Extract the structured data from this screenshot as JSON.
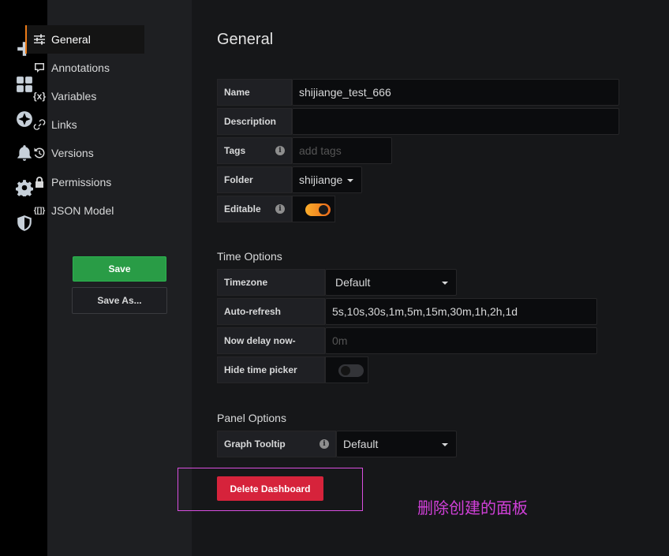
{
  "sidebar": {
    "icons": [
      "plus-icon",
      "dashboards-icon",
      "explore-icon",
      "alerting-icon",
      "configuration-icon",
      "server-admin-icon"
    ],
    "items": [
      {
        "label": "General",
        "icon": "sliders-icon",
        "active": true
      },
      {
        "label": "Annotations",
        "icon": "comment-icon"
      },
      {
        "label": "Variables",
        "icon": "variable-icon",
        "glyph": "{x}"
      },
      {
        "label": "Links",
        "icon": "link-icon"
      },
      {
        "label": "Versions",
        "icon": "history-icon"
      },
      {
        "label": "Permissions",
        "icon": "lock-icon"
      },
      {
        "label": "JSON Model",
        "icon": "json-icon",
        "glyph": "{[]}"
      }
    ],
    "save_label": "Save",
    "save_as_label": "Save As..."
  },
  "main": {
    "title": "General",
    "fields": {
      "name": {
        "label": "Name",
        "value": "shijiange_test_666"
      },
      "description": {
        "label": "Description",
        "value": ""
      },
      "tags": {
        "label": "Tags",
        "placeholder": "add tags"
      },
      "folder": {
        "label": "Folder",
        "value": "shijiange"
      },
      "editable": {
        "label": "Editable",
        "value": true
      }
    },
    "time_options": {
      "title": "Time Options",
      "timezone": {
        "label": "Timezone",
        "value": "Default"
      },
      "auto_refresh": {
        "label": "Auto-refresh",
        "value": "5s,10s,30s,1m,5m,15m,30m,1h,2h,1d"
      },
      "now_delay": {
        "label": "Now delay now-",
        "placeholder": "0m"
      },
      "hide_time_picker": {
        "label": "Hide time picker",
        "value": false
      }
    },
    "panel_options": {
      "title": "Panel Options",
      "graph_tooltip": {
        "label": "Graph Tooltip",
        "value": "Default"
      }
    },
    "delete_label": "Delete Dashboard",
    "annotation_text": "删除创建的面板"
  },
  "colors": {
    "accent": "#eb7b18",
    "save": "#299c46",
    "delete": "#d6233b",
    "annotation": "#d040d8"
  }
}
